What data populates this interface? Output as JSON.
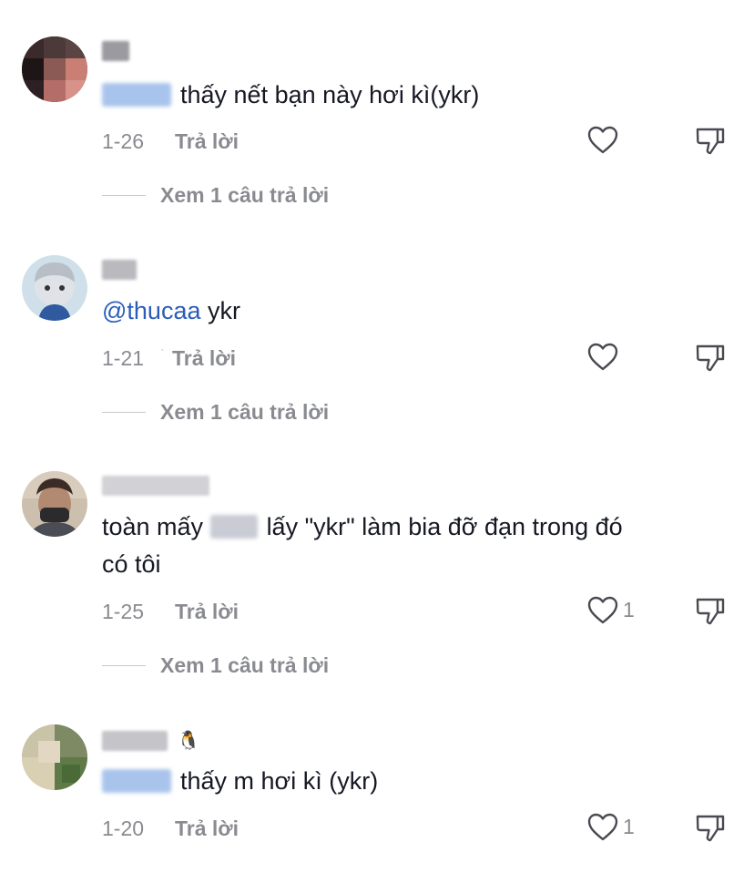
{
  "comments": [
    {
      "text": "thấy nết bạn này hơi kì(ykr)",
      "date": "1-26",
      "reply_label": "Trả lời",
      "like_count": "",
      "view_replies": "Xem 1 câu trả lời"
    },
    {
      "mention": "@thucaa",
      "text": " ykr",
      "date": "1-21",
      "reply_label": "Trả lời",
      "like_count": "",
      "view_replies": "Xem 1 câu trả lời"
    },
    {
      "text_line1_before": "toàn mấy ",
      "text_line1_after": "lấy \"ykr\" làm bia đỡ đạn trong đó",
      "text_line2": "có tôi",
      "date": "1-25",
      "reply_label": "Trả lời",
      "like_count": "1",
      "view_replies": "Xem 1 câu trả lời"
    },
    {
      "name_emoji": "🐧",
      "text": "thấy m hơi kì (ykr)",
      "date": "1-20",
      "reply_label": "Trả lời",
      "like_count": "1"
    }
  ],
  "icons": {
    "like": "heart-outline-icon",
    "dislike": "thumbs-down-outline-icon"
  },
  "colors": {
    "text": "#161823",
    "muted": "#8a8b91",
    "mention": "#2b5db8"
  }
}
